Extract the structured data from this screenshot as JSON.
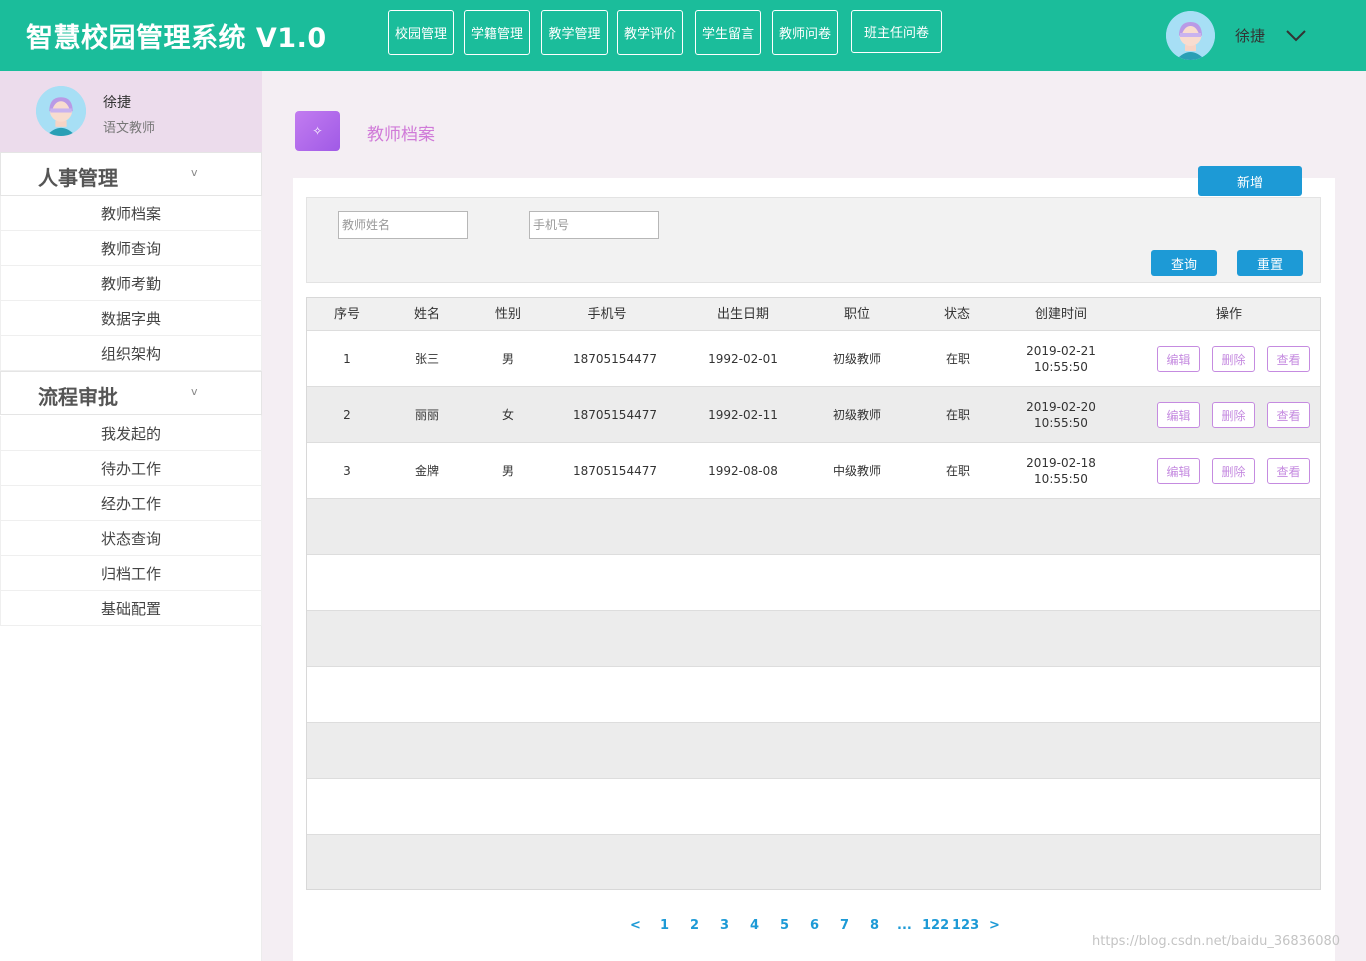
{
  "header": {
    "title": "智慧校园管理系统 V1.0",
    "nav": [
      "校园管理",
      "学籍管理",
      "教学管理",
      "教学评价",
      "学生留言",
      "教师问卷",
      "班主任问卷"
    ],
    "user_name": "徐捷"
  },
  "sidebar": {
    "profile": {
      "name": "徐捷",
      "role": "语文教师"
    },
    "groups": [
      {
        "title": "人事管理",
        "arrow": "v",
        "items": [
          "教师档案",
          "教师查询",
          "教师考勤",
          "数据字典",
          "组织架构"
        ]
      },
      {
        "title": "流程审批",
        "arrow": "v",
        "items": [
          "我发起的",
          "待办工作",
          "经办工作",
          "状态查询",
          "归档工作",
          "基础配置"
        ]
      }
    ]
  },
  "main": {
    "icon_glyph": "✧",
    "page_title": "教师档案",
    "add_label": "新增",
    "search": {
      "name_placeholder": "教师姓名",
      "phone_placeholder": "手机号",
      "query_label": "查询",
      "reset_label": "重置"
    },
    "table": {
      "headers": [
        "序号",
        "姓名",
        "性别",
        "手机号",
        "出生日期",
        "职位",
        "状态",
        "创建时间",
        "操作"
      ],
      "rows": [
        {
          "no": "1",
          "name": "张三",
          "gender": "男",
          "phone": "18705154477",
          "birth": "1992-02-01",
          "position": "初级教师",
          "status": "在职",
          "created_date": "2019-02-21",
          "created_time": "10:55:50"
        },
        {
          "no": "2",
          "name": "丽丽",
          "gender": "女",
          "phone": "18705154477",
          "birth": "1992-02-11",
          "position": "初级教师",
          "status": "在职",
          "created_date": "2019-02-20",
          "created_time": "10:55:50"
        },
        {
          "no": "3",
          "name": "金牌",
          "gender": "男",
          "phone": "18705154477",
          "birth": "1992-08-08",
          "position": "中级教师",
          "status": "在职",
          "created_date": "2019-02-18",
          "created_time": "10:55:50"
        }
      ],
      "ops": {
        "edit": "编辑",
        "delete": "删除",
        "view": "查看"
      }
    },
    "pagination": [
      "<",
      "1",
      "2",
      "3",
      "4",
      "5",
      "6",
      "7",
      "8",
      "...",
      "122",
      "123",
      ">"
    ]
  },
  "watermark": "https://blog.csdn.net/baidu_36836080",
  "colors": {
    "header": "#1bbd9b",
    "accent": "#1d9ad6",
    "op": "#c58be0",
    "title": "#d07ad8"
  }
}
